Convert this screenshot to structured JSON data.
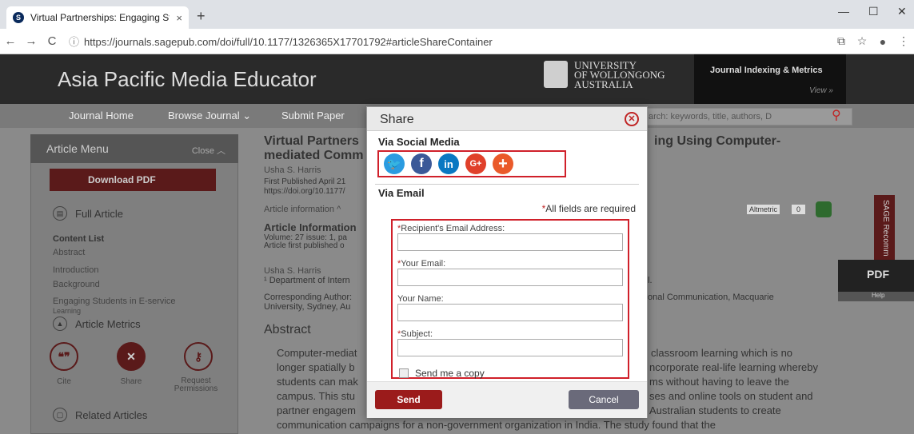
{
  "browser": {
    "tab_title": "Virtual Partnerships: Engaging St",
    "tab_close": "×",
    "new_tab": "+",
    "url": "https://journals.sagepub.com/doi/full/10.1177/1326365X17701792#articleShareContainer",
    "win_min": "—",
    "win_max": "☐",
    "win_close": "✕"
  },
  "site": {
    "title": "Asia Pacific Media Educator",
    "university_line1": "UNIVERSITY",
    "university_line2": "OF WOLLONGONG",
    "university_line3": "AUSTRALIA",
    "indexing": "Journal Indexing & Metrics",
    "indexing_view": "View »"
  },
  "journal_nav": {
    "home": "Journal Home",
    "browse": "Browse Journal ⌄",
    "submit": "Submit Paper",
    "search_placeholder": "arch: keywords, title, authors, D"
  },
  "sidebar": {
    "menu_title": "Article Menu",
    "close": "Close ︿",
    "download_pdf": "Download PDF",
    "full_article": "Full Article",
    "content_list": "Content List",
    "items": [
      "Abstract",
      "Introduction",
      "Background",
      "Engaging Students in E-service",
      "Learning"
    ],
    "article_metrics": "Article Metrics",
    "cite": "Cite",
    "share": "Share",
    "request": "Request",
    "permissions": "Permissions",
    "related": "Related Articles"
  },
  "article": {
    "title_line1": "Virtual Partners",
    "title_line1_right": "ing Using Computer-",
    "title_line2": "mediated Comm",
    "author": "Usha S. Harris",
    "published": "First Published April 21",
    "doi": "https://doi.org/10.1177/",
    "info_toggle": "Article information ^",
    "altmetric": "Altmetric",
    "altmetric_score": "0",
    "info_head": "Article Information",
    "volume": "Volume: 27 issue: 1, pa",
    "first_pub": "Article first published o",
    "author2": "Usha S. Harris",
    "dept": "¹ Department of Intern",
    "dept_right": "l.",
    "corr": "Corresponding Author:",
    "corr_right": "onal Communication, Macquarie",
    "univ": "University, Sydney, Au",
    "abstract_head": "Abstract",
    "abs1_l": "Computer-mediat",
    "abs1_r": "classroom learning which is no",
    "abs2_l": "longer spatially b",
    "abs2_r": "ncorporate real-life learning whereby",
    "abs3_l": "students can mak",
    "abs3_r": "ms without having to leave the",
    "abs4_l": "campus. This stu",
    "abs4_r": "ses and online tools on student and",
    "abs5_l": "partner engagem",
    "abs5_r": "Australian students to create",
    "abs6": "communication campaigns for a non-government organization in India. The study found that the"
  },
  "side_widgets": {
    "sage": "SAGE Recomm",
    "pdf": "PDF",
    "help": "Help"
  },
  "modal": {
    "title": "Share",
    "via_social": "Via Social Media",
    "via_email": "Via Email",
    "required_note": "All fields are required",
    "recipient_label": "Recipient's Email Address:",
    "your_email_label": "Your Email:",
    "your_name_label": "Your Name:",
    "subject_label": "Subject:",
    "send_copy": "Send me a copy",
    "send": "Send",
    "cancel": "Cancel",
    "social": {
      "twitter": "🐦",
      "facebook": "f",
      "linkedin": "in",
      "googleplus": "G+",
      "more": "+"
    }
  }
}
